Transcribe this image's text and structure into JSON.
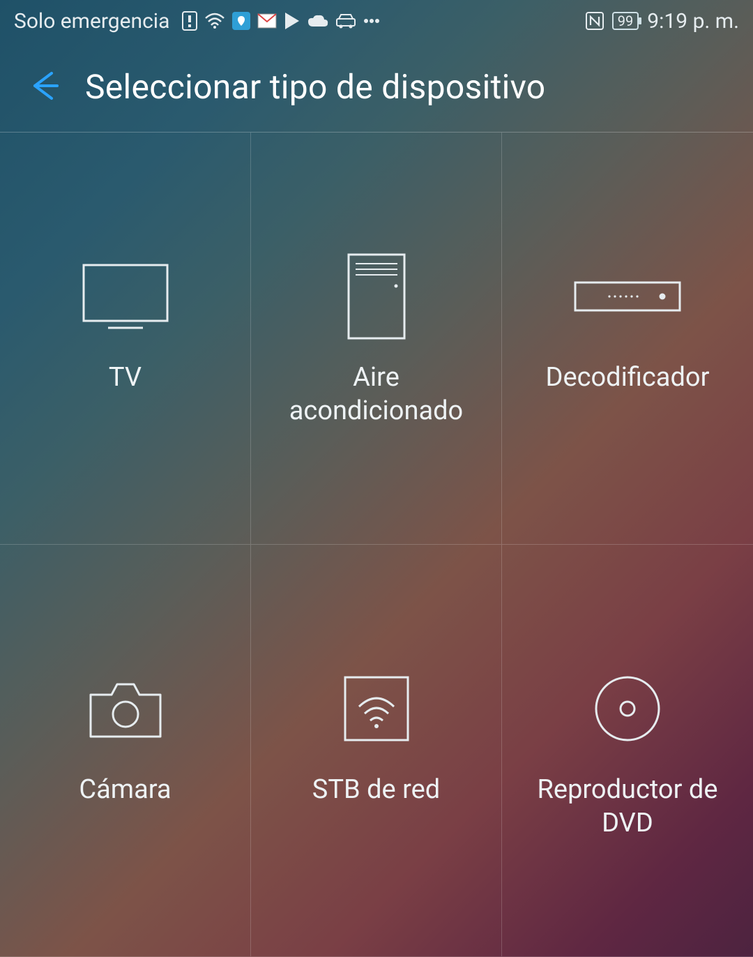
{
  "status": {
    "network_text": "Solo emergencia",
    "battery_level": "99",
    "time": "9:19 p. m."
  },
  "header": {
    "title": "Seleccionar tipo de dispositivo"
  },
  "devices": [
    {
      "label": "TV",
      "icon": "tv"
    },
    {
      "label": "Aire acondicionado",
      "icon": "ac"
    },
    {
      "label": "Decodificador",
      "icon": "stb"
    },
    {
      "label": "Cámara",
      "icon": "camera"
    },
    {
      "label": "STB de red",
      "icon": "netstb"
    },
    {
      "label": "Reproductor de DVD",
      "icon": "dvd"
    }
  ]
}
